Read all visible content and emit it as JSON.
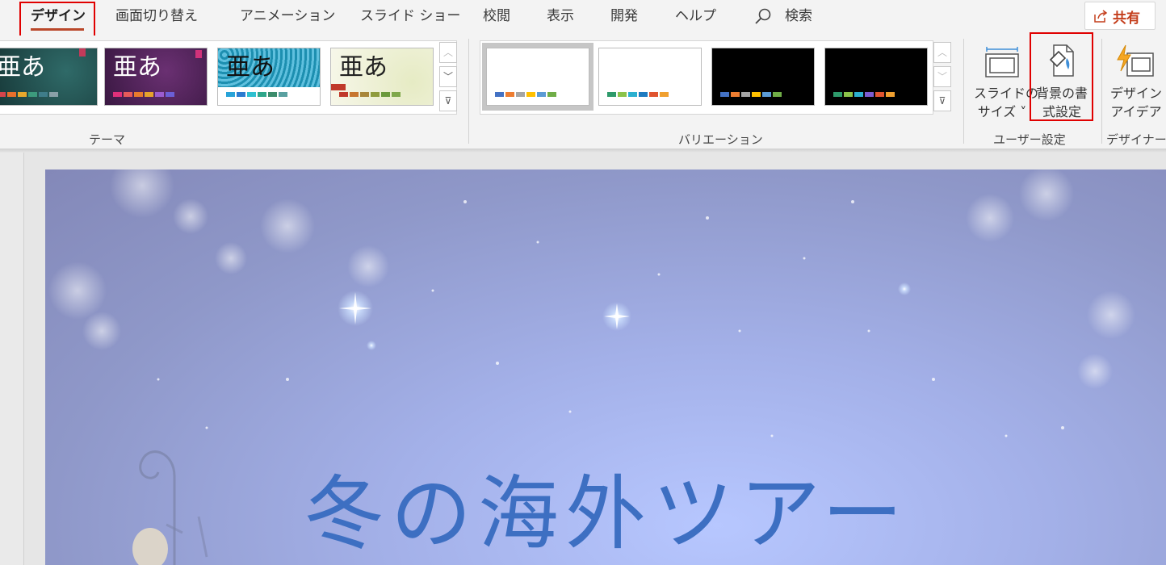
{
  "tabs": [
    {
      "label": "デザイン",
      "active": true
    },
    {
      "label": "画面切り替え"
    },
    {
      "label": "アニメーション"
    },
    {
      "label": "スライド ショー"
    },
    {
      "label": "校閲"
    },
    {
      "label": "表示"
    },
    {
      "label": "開発"
    },
    {
      "label": "ヘルプ"
    }
  ],
  "search": {
    "label": "検索",
    "icon": "search-icon"
  },
  "share": {
    "label": "共有",
    "icon": "share-icon",
    "color": "#c43e1c"
  },
  "themes": {
    "group_label": "テーマ",
    "items": [
      {
        "text": "亜あ",
        "bg": "#1f4a4a",
        "text_color": "#ffffff",
        "swatches": [
          "#d6444b",
          "#e86f2c",
          "#e8a82c",
          "#3c9a7d",
          "#3f7d8a",
          "#8aa0a8"
        ]
      },
      {
        "text": "亜あ",
        "bg": "#4a2352",
        "text_color": "#ffffff",
        "swatches": [
          "#e0307a",
          "#e65a5a",
          "#e87b2c",
          "#e6a32c",
          "#9b5ccf",
          "#6b5fd6"
        ]
      },
      {
        "text": "亜あ",
        "bg": "#1d8fb0",
        "text_color": "#111111",
        "swatches": [
          "#28a3d8",
          "#2b7bd0",
          "#2ec0d0",
          "#2ea68a",
          "#3c8c6c",
          "#5aa0a0"
        ]
      },
      {
        "text": "亜あ",
        "bg": "#f4f4e2",
        "text_color": "#222222",
        "swatches": [
          "#c0392b",
          "#c7762f",
          "#a8873a",
          "#8f9c3c",
          "#6b9a3c",
          "#7fa84a"
        ]
      }
    ]
  },
  "variations": {
    "group_label": "バリエーション",
    "items": [
      {
        "bg": "#ffffff",
        "selected": true,
        "swatches": [
          "#4472c4",
          "#ed7d31",
          "#a5a5a5",
          "#ffc000",
          "#5b9bd5",
          "#70ad47"
        ]
      },
      {
        "bg": "#ffffff",
        "swatches": [
          "#2e9a6b",
          "#8bc34a",
          "#2bb0d0",
          "#1e7bc0",
          "#e0542f",
          "#f0a030"
        ]
      },
      {
        "bg": "#000000",
        "swatches": [
          "#4472c4",
          "#ed7d31",
          "#a5a5a5",
          "#ffc000",
          "#5b9bd5",
          "#70ad47"
        ]
      },
      {
        "bg": "#000000",
        "swatches": [
          "#2e9a6b",
          "#8bc34a",
          "#2bb0d0",
          "#7b5cd0",
          "#e0542f",
          "#f0a030"
        ]
      }
    ]
  },
  "user_settings": {
    "group_label": "ユーザー設定",
    "slide_size_line1": "スライドの",
    "slide_size_line2": "サイズ ˅",
    "bg_format_line1": "背景の書",
    "bg_format_line2": "式設定"
  },
  "designer": {
    "group_label": "デザイナー",
    "line1": "デザイン",
    "line2": "アイデア"
  },
  "slide": {
    "title": "冬の海外ツアー"
  },
  "highlight_color": "#e00000"
}
